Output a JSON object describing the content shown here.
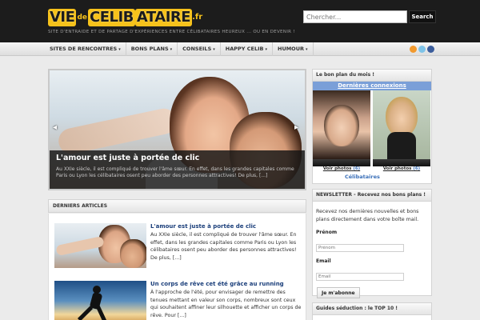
{
  "header": {
    "logo": {
      "part1": "VIE",
      "small": "de",
      "part2": "CELIB",
      "part3": "ATAIRE",
      "tld": ".fr"
    },
    "tagline": "SITE D'ENTRAIDE ET DE PARTAGE D'EXPÉRIENCES ENTRE CÉLIBATAIRES HEUREUX ... OU EN DEVENIR !",
    "search": {
      "placeholder": "Chercher...",
      "button": "Search"
    }
  },
  "nav": {
    "items": [
      {
        "label": "SITES DE RENCONTRES",
        "caret": "▾"
      },
      {
        "label": "BONS PLANS",
        "caret": "▾"
      },
      {
        "label": "CONSEILS",
        "caret": "▾"
      },
      {
        "label": "HAPPY CELIB",
        "caret": "▾"
      },
      {
        "label": "HUMOUR",
        "caret": "▾"
      }
    ],
    "social_icons": [
      "rss-icon",
      "twitter-icon",
      "facebook-icon"
    ]
  },
  "slider": {
    "title": "L'amour est juste à portée de clic",
    "text": "Au XXIe siècle, il est compliqué de trouver l'âme sœur. En effet, dans les grandes capitales comme Paris ou Lyon les célibataires osent peu aborder des personnes attractives! De plus, [...]",
    "prev": "◂",
    "next": "▸"
  },
  "articles": {
    "heading": "DERNIERS ARTICLES",
    "items": [
      {
        "title": "L'amour est juste à portée de clic",
        "text": "Au XXIe siècle, il est compliqué de trouver l'âme sœur. En effet, dans les grandes capitales comme Paris ou Lyon les célibataires osent peu aborder des personnes attractives! De plus, [...]"
      },
      {
        "title": "Un corps de rêve cet été grâce au running",
        "text": "À l'approche de l'été, pour envisager de remettre des tenues mettant en valeur son corps, nombreux sont ceux qui souhaitent affiner leur silhouette et afficher un corps de rêve. Pour [...]"
      }
    ]
  },
  "sidebar": {
    "bon_plan": {
      "heading": "Le bon plan du mois !",
      "widget_title": "Dernières connexions",
      "photos": [
        {
          "link": "Voir photos",
          "count": "(6)"
        },
        {
          "link": "Voir photos",
          "count": "(6)"
        }
      ],
      "brand": "Célibataires"
    },
    "newsletter": {
      "heading": "NEWSLETTER - Recevez nos bons plans !",
      "text": "Recevez nos dernières nouvelles et bons plans directement dans votre boîte mail.",
      "first_name_label": "Prénom",
      "first_name_placeholder": "Prénom",
      "email_label": "Email",
      "email_placeholder": "Email",
      "button": "Je m'abonne"
    },
    "top10": {
      "heading": "Guides séduction : le TOP 10 !"
    }
  },
  "colors": {
    "header_bg": "#1c1c1c",
    "logo_yellow": "#f6c21b",
    "link_blue": "#1a3e7a",
    "widget_blue": "#7a9fd8"
  }
}
